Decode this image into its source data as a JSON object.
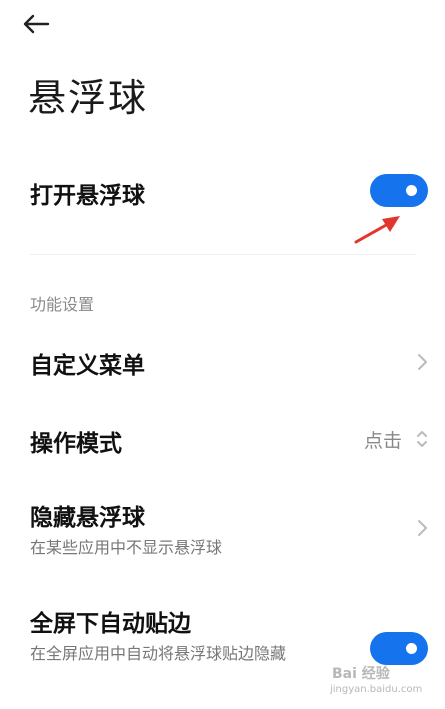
{
  "header": {
    "back_icon": "arrow-left-icon",
    "title": "悬浮球"
  },
  "main_toggle": {
    "label": "打开悬浮球",
    "enabled": true,
    "accent_color": "#1673ee"
  },
  "section": {
    "label": "功能设置"
  },
  "items": [
    {
      "label": "自定义菜单",
      "control": "chevron-right-icon"
    },
    {
      "label": "操作模式",
      "value": "点击",
      "control": "updown-chevron-icon"
    },
    {
      "label": "隐藏悬浮球",
      "sublabel": "在某些应用中不显示悬浮球",
      "control": "chevron-right-icon"
    },
    {
      "label": "全屏下自动贴边",
      "sublabel": "在全屏应用中自动将悬浮球贴边隐藏",
      "control": "toggle",
      "enabled": true
    }
  ],
  "annotation": {
    "color": "#e2362d",
    "icon": "red-arrow-icon"
  },
  "watermark": {
    "text": "Bai 经验",
    "url": "jingyan.baidu.com"
  }
}
